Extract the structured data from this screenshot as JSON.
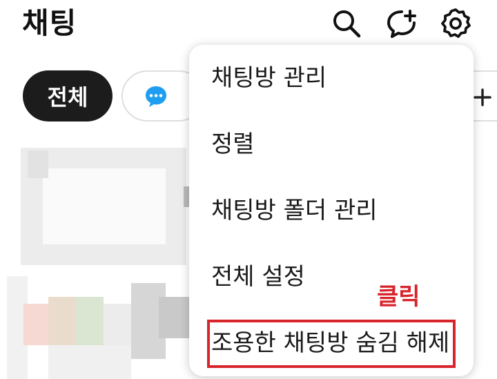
{
  "header": {
    "title": "채팅"
  },
  "filters": {
    "all_label": "전체"
  },
  "menu": {
    "items": [
      {
        "label": "채팅방 관리"
      },
      {
        "label": "정렬"
      },
      {
        "label": "채팅방 폴더 관리"
      },
      {
        "label": "전체 설정"
      },
      {
        "label": "조용한 채팅방 숨김 해제"
      }
    ]
  },
  "annotation": {
    "label": "클릭",
    "color": "#d8242b"
  },
  "colors": {
    "chip_active_bg": "#1c1c1c",
    "chat_icon_blue": "#1e9ef0"
  },
  "icons": {
    "search": "search-icon",
    "new_chat": "new-chat-icon",
    "settings": "gear-icon",
    "chat_filter": "chat-bubble-icon",
    "add_filter": "plus-icon"
  }
}
